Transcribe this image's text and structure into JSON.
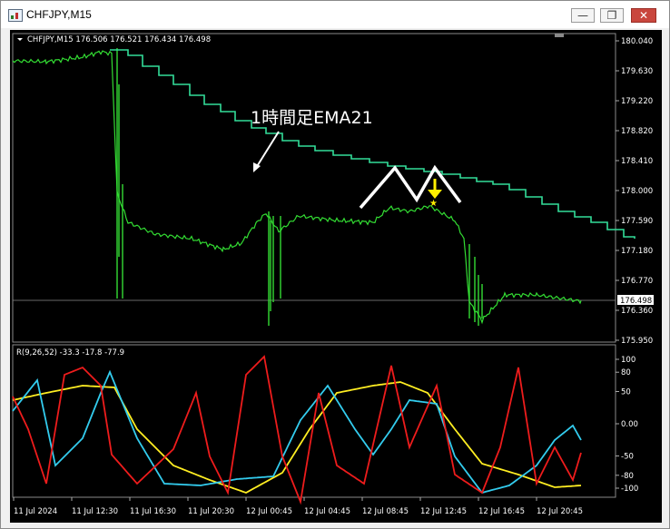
{
  "window": {
    "title": "CHFJPY,M15",
    "controls": {
      "minimize": "—",
      "restore": "❐",
      "close": "✕"
    }
  },
  "main_chart": {
    "header": "CHFJPY,M15  176.506 176.521 176.434 176.498",
    "price_ticks": [
      "180.040",
      "179.630",
      "179.220",
      "178.820",
      "178.410",
      "178.000",
      "177.590",
      "177.180",
      "176.770",
      "176.360",
      "175.950"
    ],
    "current_price": "176.498",
    "annotation": "1時間足EMA21",
    "colors": {
      "price": "#33dd33",
      "ema": "#33dd99",
      "marker": "#ffee00",
      "annotation": "#ffffff"
    }
  },
  "sub_chart": {
    "header": "R(9,26,52) -33.3 -17.8 -77.9",
    "ticks": [
      "100",
      "80",
      "50",
      "0.00",
      "-50",
      "-80",
      "-100"
    ],
    "colors": {
      "fast": "#ee1c1c",
      "mid": "#33ccee",
      "slow": "#ffee22"
    }
  },
  "time_axis": [
    "11 Jul 2024",
    "11 Jul 12:30",
    "11 Jul 16:30",
    "11 Jul 20:30",
    "12 Jul 00:45",
    "12 Jul 04:45",
    "12 Jul 08:45",
    "12 Jul 12:45",
    "12 Jul 16:45",
    "12 Jul 20:45"
  ]
}
